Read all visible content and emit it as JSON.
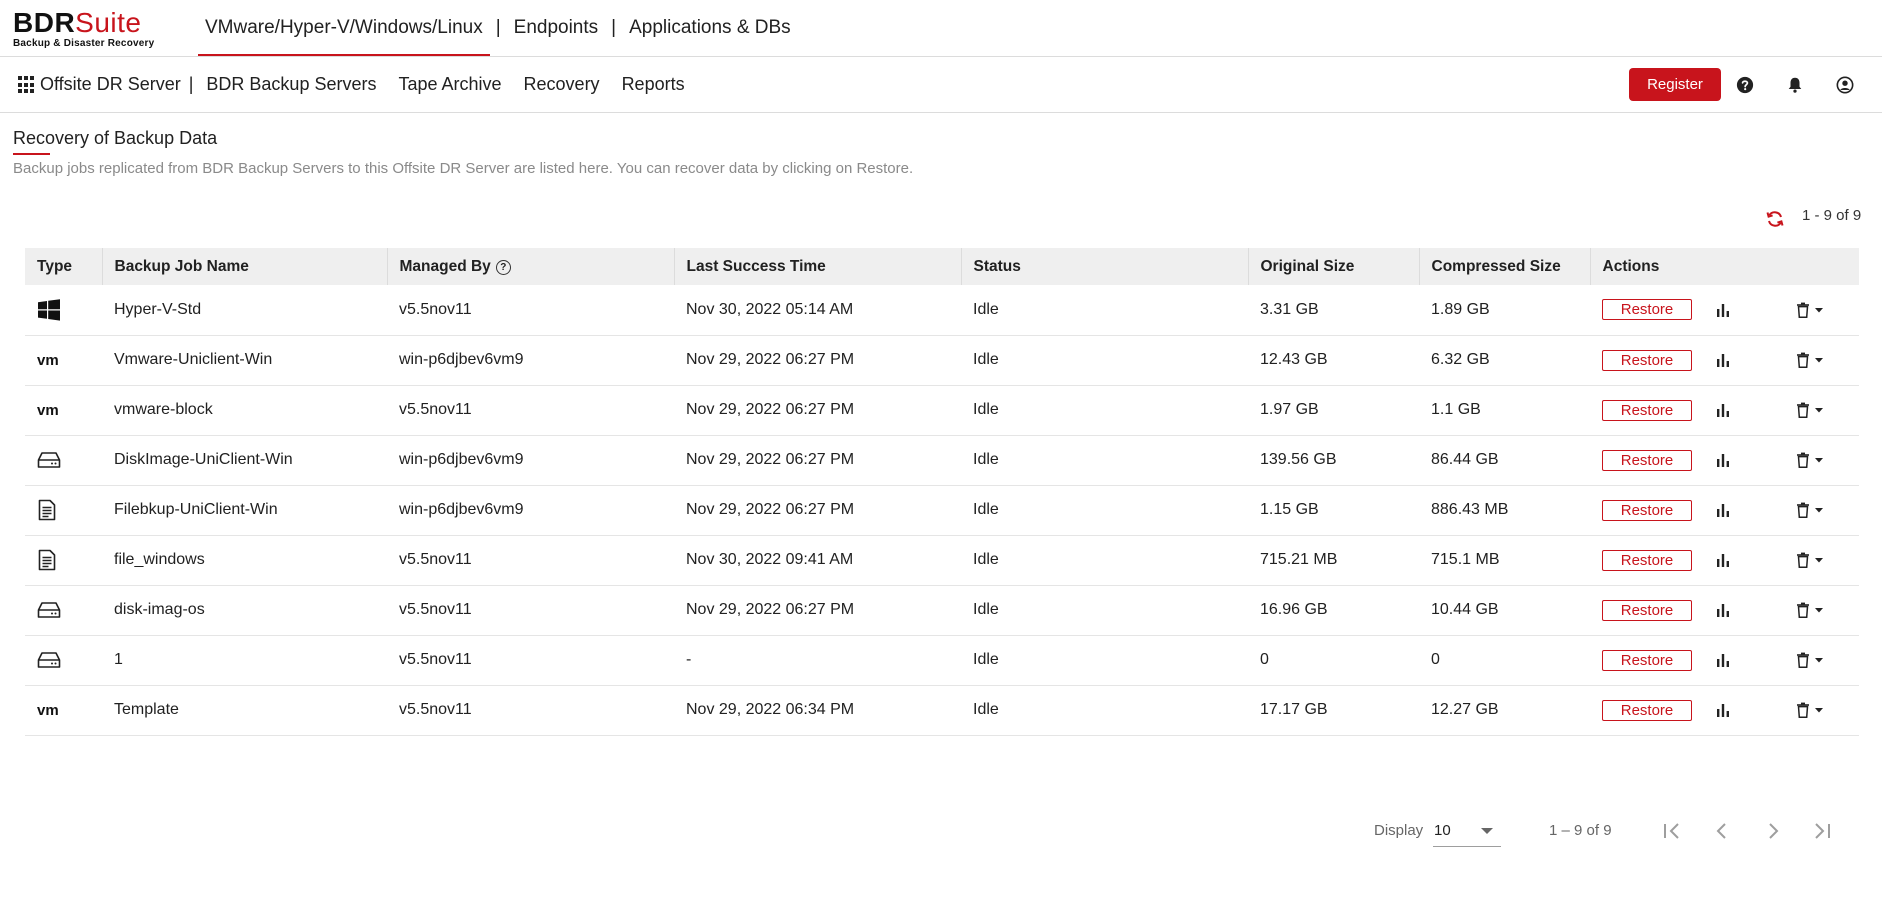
{
  "brand": {
    "name_part1": "BDR",
    "name_part2": "Suite",
    "tagline": "Backup & Disaster Recovery",
    "accent_color": "#c8141c"
  },
  "top_nav": {
    "items": [
      {
        "label": "VMware/Hyper-V/Windows/Linux",
        "active": true
      },
      {
        "label": "Endpoints",
        "active": false
      },
      {
        "label": "Applications & DBs",
        "active": false
      }
    ],
    "separator": "|"
  },
  "sub_nav": {
    "apps_icon": "grid-icon",
    "items": [
      {
        "label": "Offsite DR Server"
      },
      {
        "label": "BDR Backup Servers"
      },
      {
        "label": "Tape Archive"
      },
      {
        "label": "Recovery"
      },
      {
        "label": "Reports"
      }
    ],
    "separator": "|",
    "register_label": "Register",
    "icons": [
      "help-icon",
      "bell-icon",
      "user-icon"
    ]
  },
  "page": {
    "title": "Recovery of Backup Data",
    "description": "Backup jobs replicated from BDR Backup Servers to this Offsite DR Server are listed here. You can recover data by clicking on Restore.",
    "range_label": "1 - 9 of 9"
  },
  "table": {
    "headers": [
      "Type",
      "Backup Job Name",
      "Managed By",
      "Last Success Time",
      "Status",
      "Original Size",
      "Compressed Size",
      "Actions"
    ],
    "restore_label": "Restore",
    "rows": [
      {
        "type": "windows",
        "name": "Hyper-V-Std",
        "managed_by": "v5.5nov11",
        "last_success": "Nov 30, 2022 05:14 AM",
        "status": "Idle",
        "original_size": "3.31 GB",
        "compressed_size": "1.89 GB"
      },
      {
        "type": "vmware",
        "name": "Vmware-Uniclient-Win",
        "managed_by": "win-p6djbev6vm9",
        "last_success": "Nov 29, 2022 06:27 PM",
        "status": "Idle",
        "original_size": "12.43 GB",
        "compressed_size": "6.32 GB"
      },
      {
        "type": "vmware",
        "name": "vmware-block",
        "managed_by": "v5.5nov11",
        "last_success": "Nov 29, 2022 06:27 PM",
        "status": "Idle",
        "original_size": "1.97 GB",
        "compressed_size": "1.1 GB"
      },
      {
        "type": "disk",
        "name": "DiskImage-UniClient-Win",
        "managed_by": "win-p6djbev6vm9",
        "last_success": "Nov 29, 2022 06:27 PM",
        "status": "Idle",
        "original_size": "139.56 GB",
        "compressed_size": "86.44 GB"
      },
      {
        "type": "file",
        "name": "Filebkup-UniClient-Win",
        "managed_by": "win-p6djbev6vm9",
        "last_success": "Nov 29, 2022 06:27 PM",
        "status": "Idle",
        "original_size": "1.15 GB",
        "compressed_size": "886.43 MB"
      },
      {
        "type": "file",
        "name": "file_windows",
        "managed_by": "v5.5nov11",
        "last_success": "Nov 30, 2022 09:41 AM",
        "status": "Idle",
        "original_size": "715.21 MB",
        "compressed_size": "715.1 MB"
      },
      {
        "type": "disk",
        "name": "disk-imag-os",
        "managed_by": "v5.5nov11",
        "last_success": "Nov 29, 2022 06:27 PM",
        "status": "Idle",
        "original_size": "16.96 GB",
        "compressed_size": "10.44 GB"
      },
      {
        "type": "disk",
        "name": "1",
        "managed_by": "v5.5nov11",
        "last_success": "-",
        "status": "Idle",
        "original_size": "0",
        "compressed_size": "0"
      },
      {
        "type": "vmware",
        "name": "Template",
        "managed_by": "v5.5nov11",
        "last_success": "Nov 29, 2022 06:34 PM",
        "status": "Idle",
        "original_size": "17.17 GB",
        "compressed_size": "12.27 GB"
      }
    ]
  },
  "pagination": {
    "display_label": "Display",
    "page_size": "10",
    "range": "1 – 9 of 9"
  }
}
